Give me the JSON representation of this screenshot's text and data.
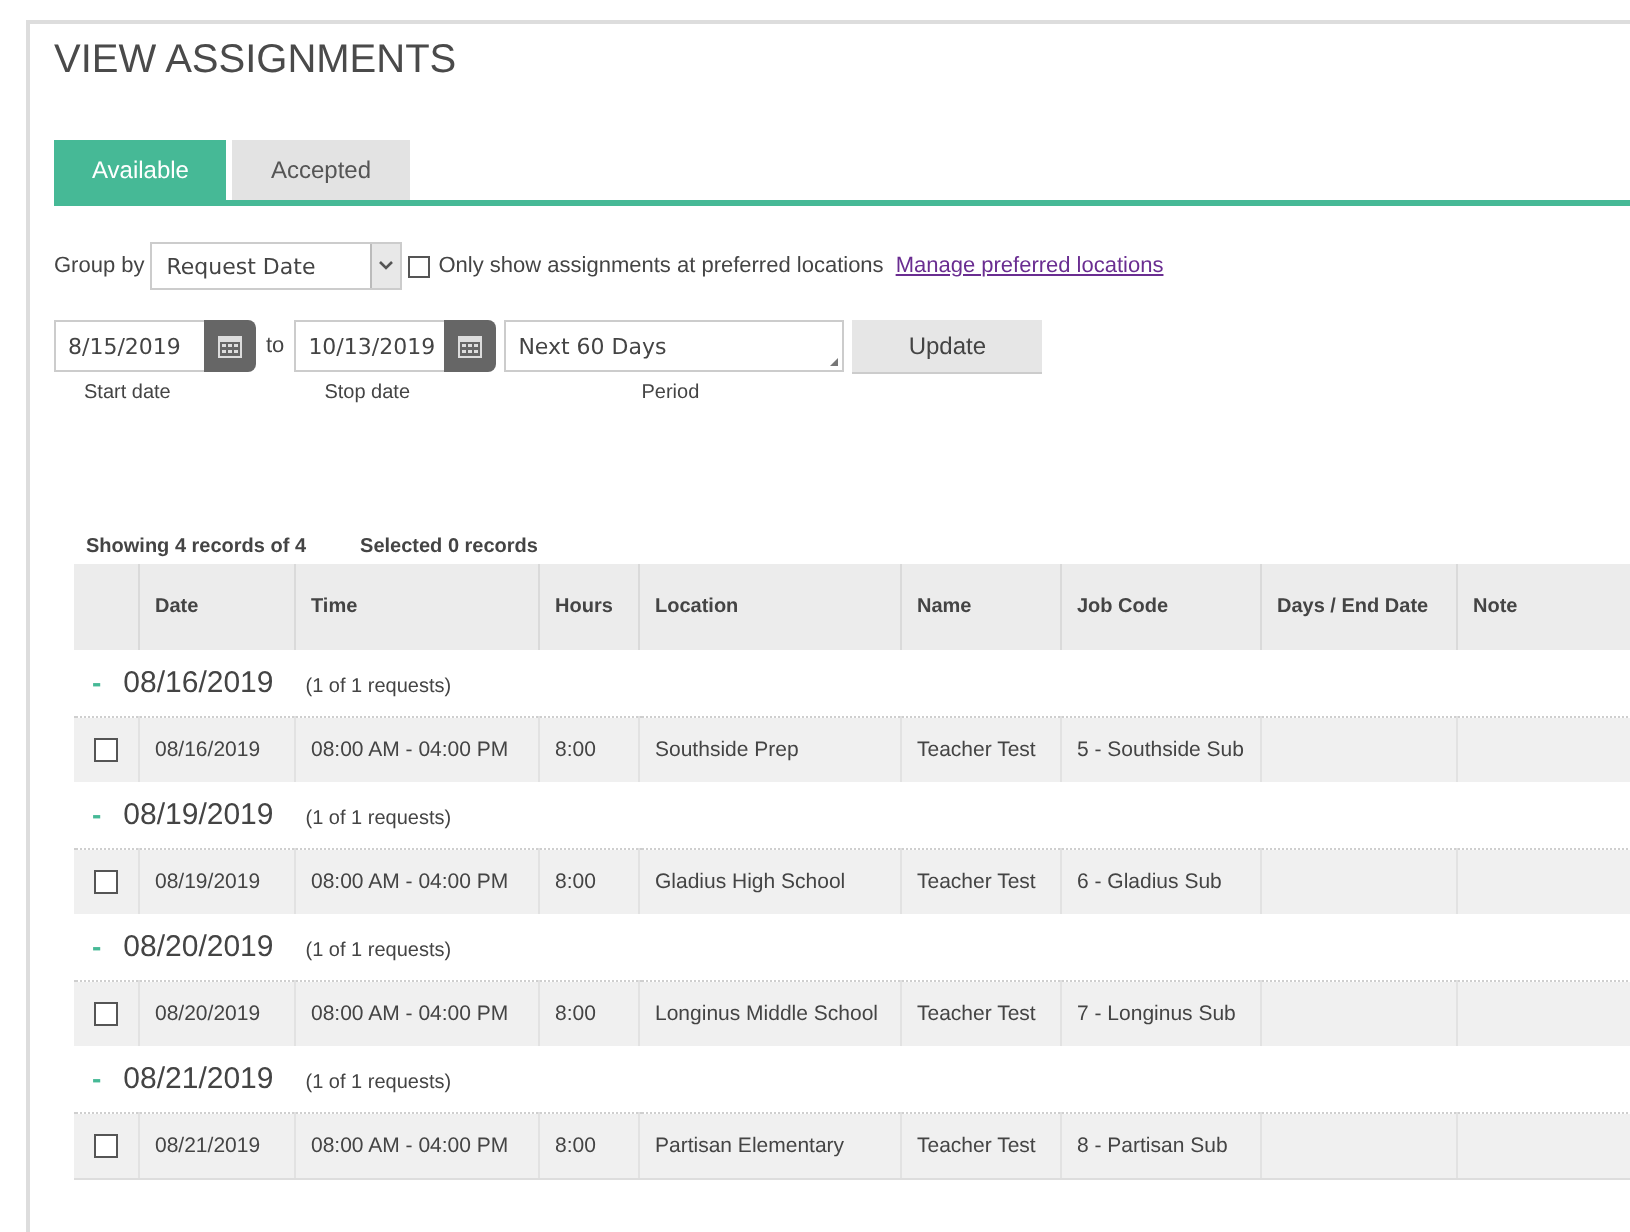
{
  "page": {
    "title": "VIEW ASSIGNMENTS"
  },
  "tabs": [
    {
      "label": "Available",
      "selected": true
    },
    {
      "label": "Accepted",
      "selected": false
    }
  ],
  "filters": {
    "group_by_label": "Group by",
    "group_by_value": "Request Date",
    "preferred_only": {
      "label": "Only show assignments at preferred locations",
      "checked": false
    },
    "manage_link": "Manage preferred locations",
    "start_date": {
      "value": "8/15/2019",
      "label": "Start date"
    },
    "to": "to",
    "stop_date": {
      "value": "10/13/2019",
      "label": "Stop date"
    },
    "period": {
      "value": "Next 60 Days",
      "label": "Period"
    },
    "update_button": "Update"
  },
  "summary": {
    "showing": "Showing 4 records of 4",
    "selected": "Selected 0 records"
  },
  "table": {
    "columns": [
      "Date",
      "Time",
      "Hours",
      "Location",
      "Name",
      "Job Code",
      "Days / End Date",
      "Note"
    ],
    "groups": [
      {
        "toggle": "-",
        "date": "08/16/2019",
        "count": "(1 of 1 requests)",
        "rows": [
          {
            "checked": false,
            "cells": [
              "08/16/2019",
              "08:00 AM - 04:00 PM",
              "8:00",
              "Southside Prep",
              "Teacher Test",
              "5 - Southside Sub"
            ]
          }
        ]
      },
      {
        "toggle": "-",
        "date": "08/19/2019",
        "count": "(1 of 1 requests)",
        "rows": [
          {
            "checked": false,
            "cells": [
              "08/19/2019",
              "08:00 AM - 04:00 PM",
              "8:00",
              "Gladius High School",
              "Teacher Test",
              "6 - Gladius Sub"
            ]
          }
        ]
      },
      {
        "toggle": "-",
        "date": "08/20/2019",
        "count": "(1 of 1 requests)",
        "rows": [
          {
            "checked": false,
            "cells": [
              "08/20/2019",
              "08:00 AM - 04:00 PM",
              "8:00",
              "Longinus Middle School",
              "Teacher Test",
              "7 - Longinus Sub"
            ]
          }
        ]
      },
      {
        "toggle": "-",
        "date": "08/21/2019",
        "count": "(1 of 1 requests)",
        "rows": [
          {
            "checked": false,
            "cells": [
              "08/21/2019",
              "08:00 AM - 04:00 PM",
              "8:00",
              "Partisan Elementary",
              "Teacher Test",
              "8 - Partisan Sub"
            ]
          }
        ]
      }
    ]
  }
}
